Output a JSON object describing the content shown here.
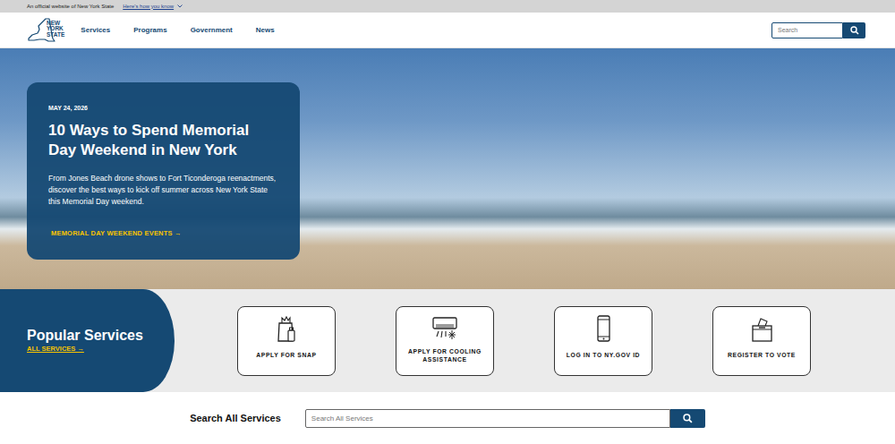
{
  "top_bar": {
    "official": "An official website of New York State",
    "how_you_know": "Here's how you know"
  },
  "header": {
    "logo": [
      "NEW",
      "YORK",
      "STATE"
    ],
    "nav": [
      {
        "label": "Services"
      },
      {
        "label": "Programs"
      },
      {
        "label": "Government"
      },
      {
        "label": "News"
      }
    ],
    "search": {
      "placeholder": "Search"
    }
  },
  "hero": {
    "date": "MAY 24, 2026",
    "title": "10 Ways to Spend Memorial Day Weekend in New York",
    "description": "From Jones Beach drone shows to Fort Ticonderoga reenactments, discover the best ways to kick off summer across New York State this Memorial Day weekend.",
    "link": "MEMORIAL DAY WEEKEND EVENTS →"
  },
  "popular_services": {
    "heading": "Popular Services",
    "link": "ALL SERVICES →",
    "tiles": [
      {
        "label": "APPLY FOR SNAP"
      },
      {
        "label": "APPLY FOR COOLING ASSISTANCE"
      },
      {
        "label": "LOG IN TO NY.GOV ID"
      },
      {
        "label": "REGISTER TO VOTE"
      }
    ]
  },
  "search_all": {
    "label": "Search All Services",
    "placeholder": "Search All Services"
  }
}
